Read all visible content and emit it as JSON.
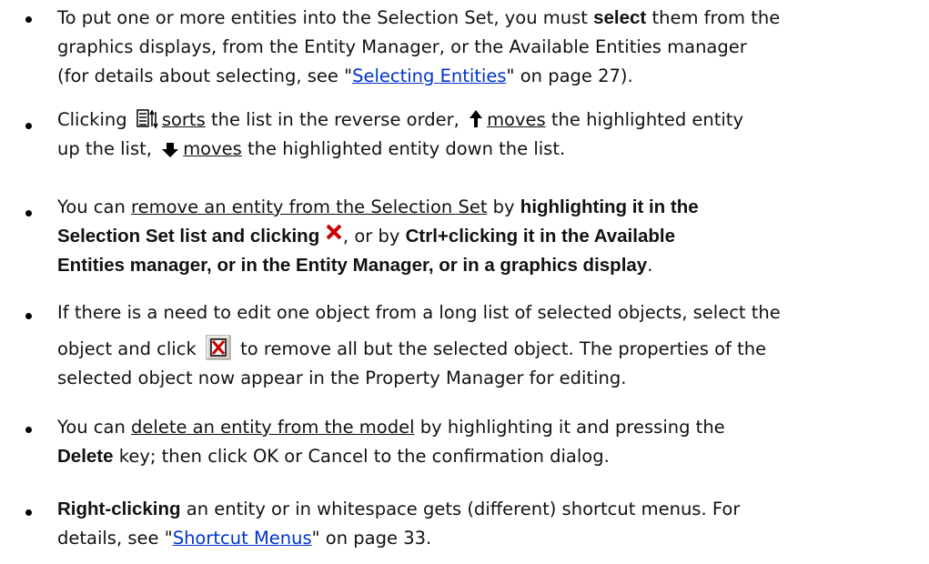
{
  "items": [
    {
      "l1": "To put one or more entities into the Selection Set, you must ",
      "l1_bold": "select",
      "l1_tail": " them from the",
      "l2": "graphics displays, from the Entity Manager, or the Available Entities manager",
      "l3_pre": "(for details about selecting, see \"",
      "l3_link": "Selecting Entities",
      "l3_post": "\" on page 27)."
    },
    {
      "l1_a": "Clicking ",
      "sorts": "sorts",
      "l1_b": " the list in the reverse order, ",
      "moves1": "moves",
      "l1_c": " the highlighted entity",
      "l2_a": "up the list, ",
      "moves2": "moves",
      "l2_b": " the highlighted entity down the list."
    },
    {
      "l1_a": "You can ",
      "l1_u": "remove an entity from the Selection Set",
      "l1_b": " by ",
      "l1_bold": "highlighting it in the",
      "l2_bold": "Selection Set list and clicking ",
      "l2_mid": ", or by ",
      "l2_bold2": "Ctrl+clicking it in the Available",
      "l3_bold": "Entities manager, or in the Entity Manager, or in a graphics display",
      "l3_tail": "."
    },
    {
      "l1": "If there is a need to edit one object from a long list of selected objects, select the",
      "l2_a": "object and click ",
      "l2_b": " to remove all but the selected object. The properties of the",
      "l3": "selected object now appear in the Property Manager for editing."
    },
    {
      "l1_a": "You can ",
      "l1_u": "delete an entity from the model",
      "l1_b": " by highlighting it and pressing the",
      "l2_bold": "Delete",
      "l2_tail": " key; then click OK or Cancel to the confirmation dialog."
    },
    {
      "l1_bold": "Right-clicking",
      "l1_tail": " an entity or in whitespace gets (different) shortcut menus. For",
      "l2_pre": "details, see \"",
      "l2_link": "Shortcut Menus",
      "l2_post": "\" on page 33."
    }
  ],
  "icons": {
    "sort": "sort-reverse-icon",
    "up": "arrow-up-icon",
    "down": "arrow-down-icon",
    "remove": "red-x-remove-icon",
    "remove_all_but": "remove-all-but-selected-icon"
  },
  "colors": {
    "link": "#0033cc",
    "remove_icon": "#cc0000"
  }
}
